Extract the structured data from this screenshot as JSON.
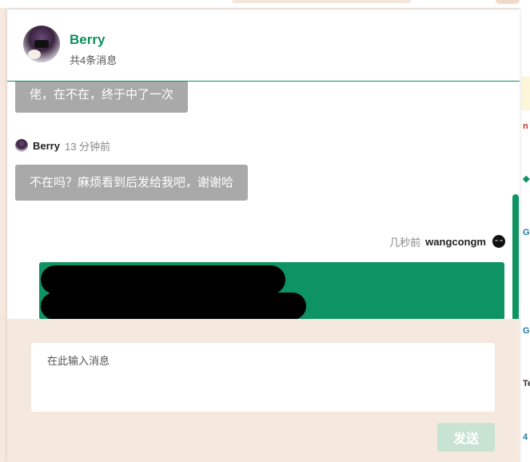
{
  "chat": {
    "contact_name": "Berry",
    "message_count": "共4条消息"
  },
  "messages": [
    {
      "side": "left",
      "text": "佬，在不在，终于中了一次"
    },
    {
      "side": "left",
      "sender": "Berry",
      "time": "13 分钟前",
      "text": "不在吗？麻烦看到后发给我吧，谢谢哈"
    },
    {
      "side": "right",
      "sender": "wangcongm",
      "time": "几秒前",
      "text_redacted": true
    }
  ],
  "composer": {
    "placeholder": "在此输入消息",
    "send_label": "发送"
  },
  "host_peek": {
    "item1": "n",
    "item2": "G",
    "item3": "G",
    "item4": "Te",
    "item5": "4"
  },
  "colors": {
    "accent": "#0e9462",
    "name": "#0e8f5e",
    "bubble_gray": "#a9a9a9",
    "composer_bg": "#f5e8df",
    "send_disabled": "#c9e3d2"
  },
  "icons": {
    "contact_avatar": "avatar",
    "self_avatar": "avatar"
  }
}
